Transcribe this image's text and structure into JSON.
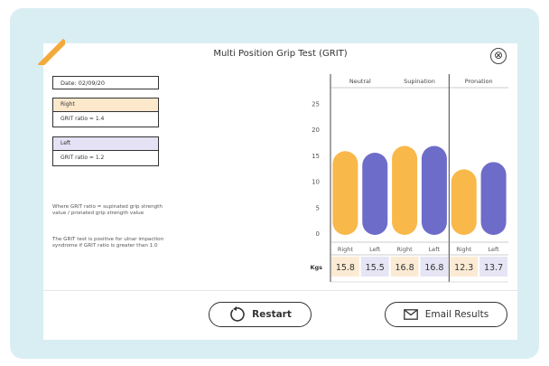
{
  "modal": {
    "title": "Multi Position Grip Test (GRIT)",
    "close_label": "⊗"
  },
  "info": {
    "date": "Date: 02/09/20",
    "right_label": "Right",
    "right_ratio": "GRIT ratio = 1.4",
    "left_label": "Left",
    "left_ratio": "GRIT ratio = 1.2",
    "note1": "Where GRIT ratio = supinated grip strength value / pronated grip strength value",
    "note2": "The GRIT test is positive for ulnar impaction syndrome if GRIT ratio is greater than 1.0"
  },
  "buttons": {
    "restart": "Restart",
    "email": "Email Results"
  },
  "chart_data": {
    "type": "bar",
    "groups": [
      "Neutral",
      "Supination",
      "Pronation"
    ],
    "categories": [
      "Right",
      "Left",
      "Right",
      "Left",
      "Right",
      "Left"
    ],
    "values": [
      15.8,
      15.5,
      16.8,
      16.8,
      12.3,
      13.7
    ],
    "value_labels": [
      "15.8",
      "15.5",
      "16.8",
      "16.8",
      "12.3",
      "13.7"
    ],
    "row_label": "Kgs",
    "yticks": [
      "0",
      "5",
      "10",
      "15",
      "20",
      "25"
    ],
    "ylim": [
      0,
      27
    ],
    "colors": {
      "Right": "#f9b84a",
      "Left": "#6e6cc9"
    },
    "value_cell_colors": {
      "Right": "#fcebd4",
      "Left": "#e6e5f5"
    }
  }
}
